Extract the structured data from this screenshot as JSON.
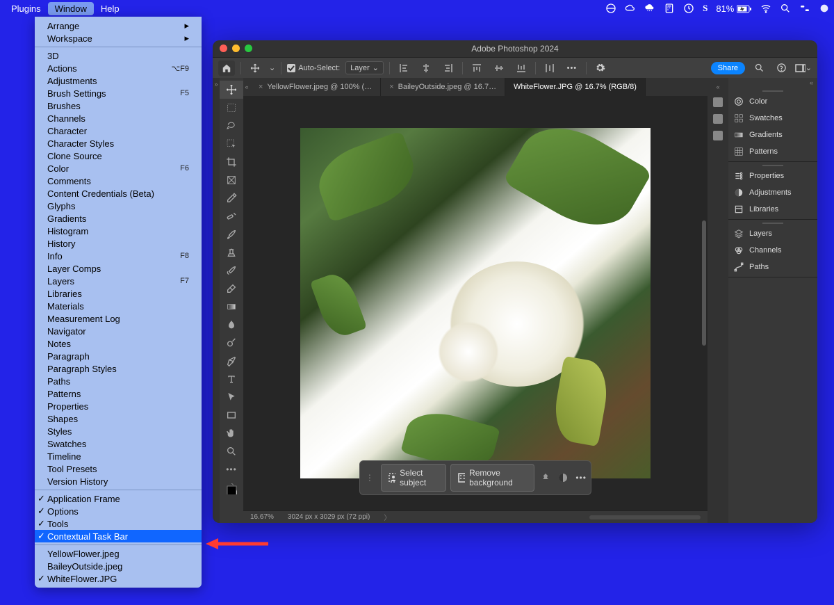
{
  "menubar": {
    "items": [
      "Plugins",
      "Window",
      "Help"
    ],
    "active_index": 1,
    "battery": "81%"
  },
  "dropdown": {
    "groups": [
      [
        {
          "label": "Arrange",
          "submenu": true
        },
        {
          "label": "Workspace",
          "submenu": true
        }
      ],
      [
        {
          "label": "3D"
        },
        {
          "label": "Actions",
          "shortcut": "⌥F9"
        },
        {
          "label": "Adjustments"
        },
        {
          "label": "Brush Settings",
          "shortcut": "F5"
        },
        {
          "label": "Brushes"
        },
        {
          "label": "Channels"
        },
        {
          "label": "Character"
        },
        {
          "label": "Character Styles"
        },
        {
          "label": "Clone Source"
        },
        {
          "label": "Color",
          "shortcut": "F6"
        },
        {
          "label": "Comments"
        },
        {
          "label": "Content Credentials (Beta)"
        },
        {
          "label": "Glyphs"
        },
        {
          "label": "Gradients"
        },
        {
          "label": "Histogram"
        },
        {
          "label": "History"
        },
        {
          "label": "Info",
          "shortcut": "F8"
        },
        {
          "label": "Layer Comps"
        },
        {
          "label": "Layers",
          "shortcut": "F7"
        },
        {
          "label": "Libraries"
        },
        {
          "label": "Materials"
        },
        {
          "label": "Measurement Log"
        },
        {
          "label": "Navigator"
        },
        {
          "label": "Notes"
        },
        {
          "label": "Paragraph"
        },
        {
          "label": "Paragraph Styles"
        },
        {
          "label": "Paths"
        },
        {
          "label": "Patterns"
        },
        {
          "label": "Properties"
        },
        {
          "label": "Shapes"
        },
        {
          "label": "Styles"
        },
        {
          "label": "Swatches"
        },
        {
          "label": "Timeline"
        },
        {
          "label": "Tool Presets"
        },
        {
          "label": "Version History"
        }
      ],
      [
        {
          "label": "Application Frame",
          "checked": true
        },
        {
          "label": "Options",
          "checked": true
        },
        {
          "label": "Tools",
          "checked": true
        },
        {
          "label": "Contextual Task Bar",
          "checked": true,
          "selected": true
        }
      ],
      [
        {
          "label": "YellowFlower.jpeg"
        },
        {
          "label": "BaileyOutside.jpeg"
        },
        {
          "label": "WhiteFlower.JPG",
          "checked": true
        }
      ]
    ]
  },
  "ps": {
    "title": "Adobe Photoshop 2024",
    "options": {
      "auto_select": "Auto-Select:",
      "layer": "Layer",
      "share": "Share"
    },
    "tabs": [
      {
        "label": "YellowFlower.jpeg @ 100% (…"
      },
      {
        "label": "BaileyOutside.jpeg @ 16.7…"
      },
      {
        "label": "WhiteFlower.JPG @ 16.7% (RGB/8)",
        "active": true
      }
    ],
    "context_bar": {
      "select_subject": "Select subject",
      "remove_bg": "Remove background"
    },
    "status": {
      "zoom": "16.67%",
      "dims": "3024 px x 3029 px (72 ppi)"
    },
    "panels": [
      [
        "Color",
        "Swatches",
        "Gradients",
        "Patterns"
      ],
      [
        "Properties",
        "Adjustments",
        "Libraries"
      ],
      [
        "Layers",
        "Channels",
        "Paths"
      ]
    ]
  }
}
